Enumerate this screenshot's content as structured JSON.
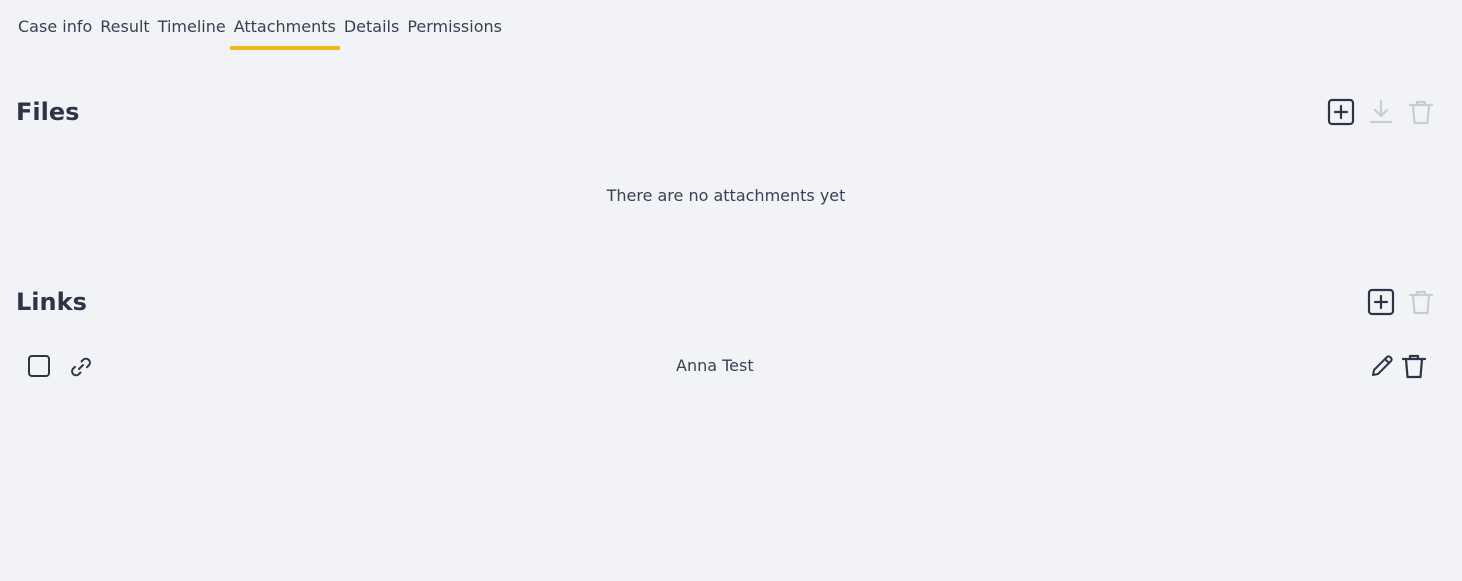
{
  "tabs": [
    {
      "label": "Case info",
      "active": false
    },
    {
      "label": "Result",
      "active": false
    },
    {
      "label": "Timeline",
      "active": false
    },
    {
      "label": "Attachments",
      "active": true
    },
    {
      "label": "Details",
      "active": false
    },
    {
      "label": "Permissions",
      "active": false
    }
  ],
  "colors": {
    "accent": "#f5b915",
    "icon_active": "#2e3448",
    "icon_disabled": "#c9ccd6",
    "background": "#f2f3f7"
  },
  "files": {
    "title": "Files",
    "empty_message": "There are no attachments yet",
    "actions": [
      {
        "icon": "add-square-icon",
        "enabled": true
      },
      {
        "icon": "download-icon",
        "enabled": false
      },
      {
        "icon": "trash-icon",
        "enabled": false
      }
    ]
  },
  "links": {
    "title": "Links",
    "actions": [
      {
        "icon": "add-square-icon",
        "enabled": true
      },
      {
        "icon": "trash-icon",
        "enabled": false
      }
    ],
    "items": [
      {
        "name": "Anna Test",
        "checked": false,
        "icon": "link-icon",
        "actions": [
          "pencil-icon",
          "trash-icon"
        ]
      }
    ]
  }
}
